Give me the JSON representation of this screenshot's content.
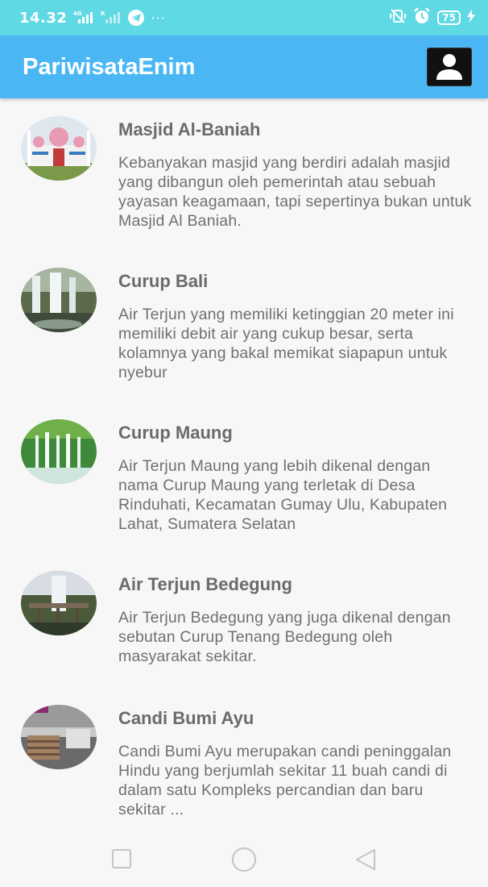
{
  "status_bar": {
    "time": "14.32",
    "signal_1": "4G",
    "signal_2": "R",
    "dots": "···",
    "battery": "75"
  },
  "app_bar": {
    "title": "PariwisataEnim",
    "profile_icon": "account-icon"
  },
  "items": [
    {
      "title": "Masjid Al-Baniah",
      "description": "Kebanyakan masjid yang berdiri adalah masjid yang dibangun oleh pemerintah atau sebuah yayasan keagamaan, tapi sepertinya bukan untuk Masjid Al Baniah."
    },
    {
      "title": "Curup Bali",
      "description": "Air Terjun yang memiliki ketinggian 20 meter ini memiliki debit air yang cukup besar, serta kolamnya yang bakal memikat siapapun untuk nyebur"
    },
    {
      "title": "Curup Maung",
      "description": "Air Terjun Maung yang lebih dikenal dengan nama Curup Maung yang terletak di Desa Rinduhati, Kecamatan Gumay Ulu, Kabupaten Lahat, Sumatera Selatan"
    },
    {
      "title": "Air Terjun Bedegung",
      "description": "Air Terjun Bedegung yang juga dikenal dengan sebutan Curup Tenang Bedegung oleh masyarakat sekitar."
    },
    {
      "title": "Candi Bumi Ayu",
      "description": "Candi Bumi Ayu merupakan candi peninggalan Hindu yang berjumlah sekitar 11 buah candi di dalam satu Kompleks percandian dan baru sekitar ..."
    }
  ],
  "nav": {
    "recents_icon": "square-icon",
    "home_icon": "circle-icon",
    "back_icon": "triangle-back-icon"
  },
  "colors": {
    "status_bar": "#5fd9e3",
    "app_bar": "#4ab7f4",
    "title_text": "#6b6b6b",
    "body_text": "#707070"
  }
}
